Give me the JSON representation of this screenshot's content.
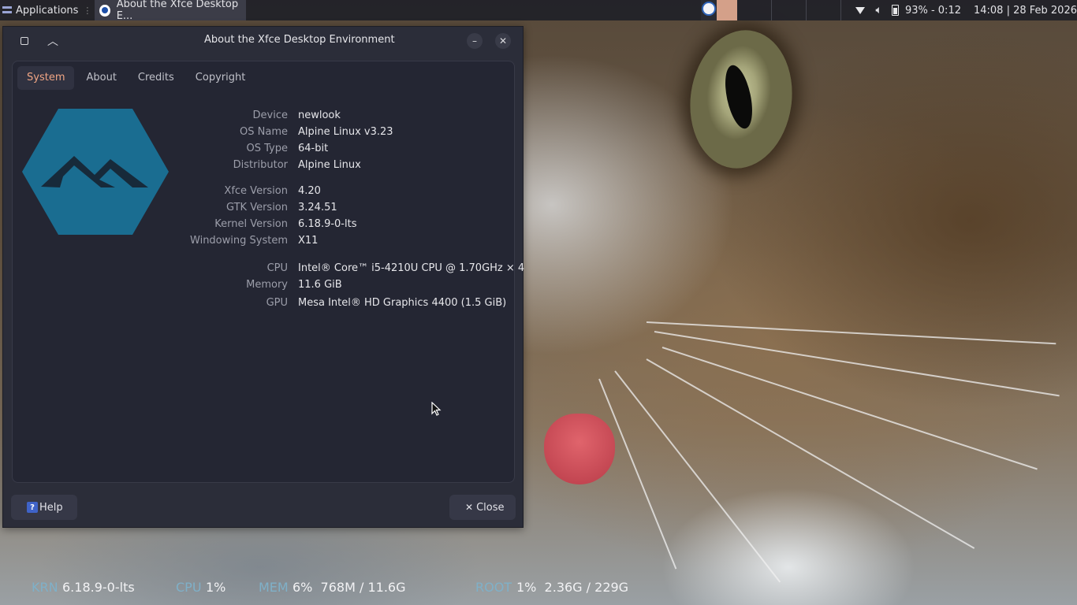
{
  "top_panel": {
    "applications_label": "Applications",
    "task_title": "About the Xfce Desktop E...",
    "battery_text": "93% - 0:12",
    "clock_text": "14:08 | 28 Feb 2026"
  },
  "window": {
    "title": "About the Xfce Desktop Environment",
    "tabs": [
      {
        "label": "System",
        "active": true
      },
      {
        "label": "About",
        "active": false
      },
      {
        "label": "Credits",
        "active": false
      },
      {
        "label": "Copyright",
        "active": false
      }
    ],
    "logo_color": "#1a6d91",
    "info": [
      {
        "label": "Device",
        "value": "newlook"
      },
      {
        "label": "OS Name",
        "value": "Alpine Linux v3.23"
      },
      {
        "label": "OS Type",
        "value": "64-bit"
      },
      {
        "label": "Distributor",
        "value": "Alpine Linux"
      },
      {
        "label": "Xfce Version",
        "value": "4.20"
      },
      {
        "label": "GTK Version",
        "value": "3.24.51"
      },
      {
        "label": "Kernel Version",
        "value": "6.18.9-0-lts"
      },
      {
        "label": "Windowing System",
        "value": "X11"
      },
      {
        "label": "CPU",
        "value": "Intel® Core™ i5-4210U CPU @ 1.70GHz × 4"
      },
      {
        "label": "Memory",
        "value": "11.6 GiB"
      },
      {
        "label": "GPU",
        "value": "Mesa Intel® HD Graphics 4400 (1.5 GiB)"
      }
    ],
    "help_label": "Help",
    "close_label": "Close",
    "accent_color": "#f0a584"
  },
  "conky": {
    "krn_key": "KRN",
    "krn_val": "6.18.9-0-lts",
    "cpu_key": "CPU",
    "cpu_val": "1%",
    "mem_key": "MEM",
    "mem_val": "6%  768M / 11.6G",
    "root_key": "ROOT",
    "root_val": "1%  2.36G / 229G"
  },
  "icons": {
    "window_menu": "window-menu-icon",
    "shade": "chevron-up-icon",
    "minimize": "minimize-icon",
    "close": "close-icon",
    "network": "wifi-icon",
    "volume": "volume-icon",
    "battery": "battery-icon"
  }
}
